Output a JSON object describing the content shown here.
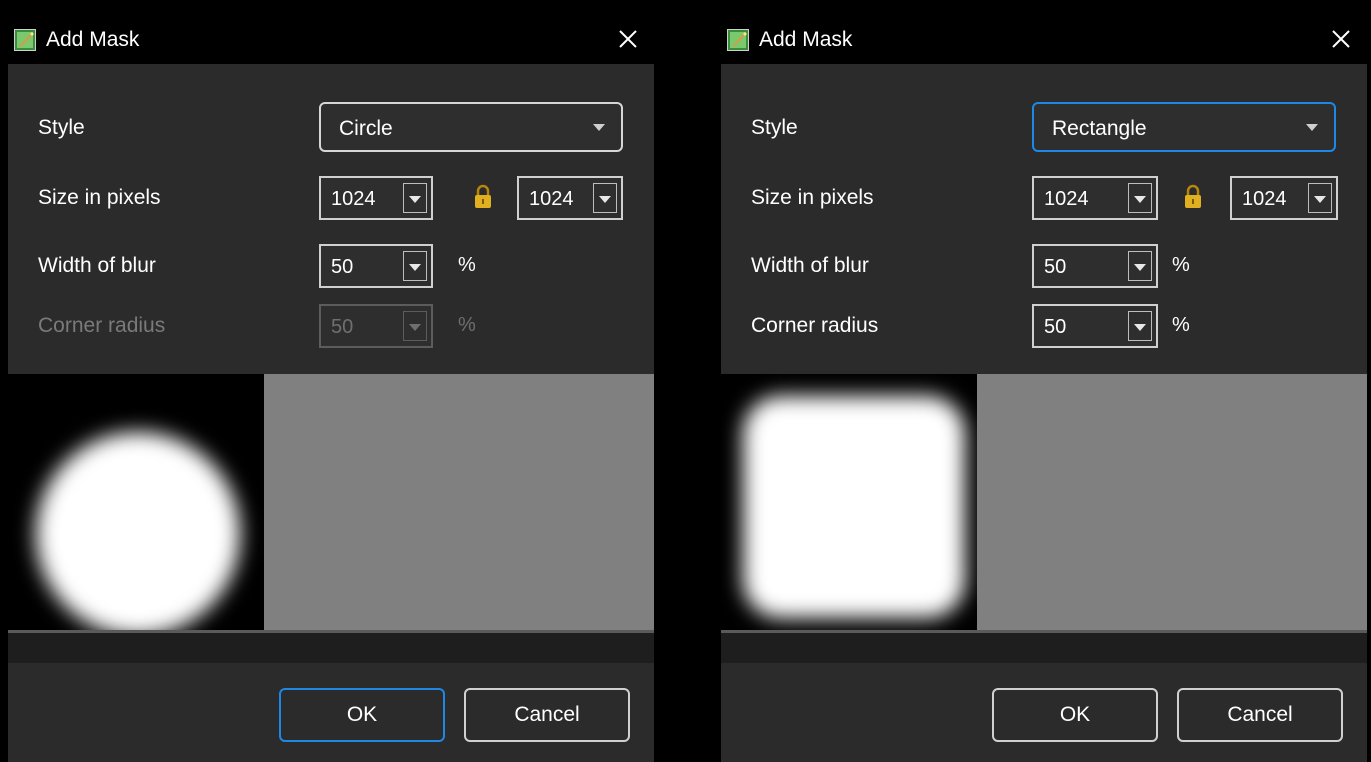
{
  "dialogs": [
    {
      "title": "Add Mask",
      "style_label": "Style",
      "style_value": "Circle",
      "size_label": "Size in pixels",
      "size_width": "1024",
      "size_height": "1024",
      "blur_label": "Width of blur",
      "blur_value": "50",
      "blur_unit": "%",
      "corner_label": "Corner radius",
      "corner_value": "50",
      "corner_unit": "%",
      "corner_enabled": false,
      "preview_shape": "circle",
      "ok_label": "OK",
      "cancel_label": "Cancel",
      "default_button": "ok"
    },
    {
      "title": "Add Mask",
      "style_label": "Style",
      "style_value": "Rectangle",
      "size_label": "Size in pixels",
      "size_width": "1024",
      "size_height": "1024",
      "blur_label": "Width of blur",
      "blur_value": "50",
      "blur_unit": "%",
      "corner_label": "Corner radius",
      "corner_value": "50",
      "corner_unit": "%",
      "corner_enabled": true,
      "preview_shape": "rounded-rectangle",
      "ok_label": "OK",
      "cancel_label": "Cancel",
      "default_button": "none"
    }
  ],
  "icons": {
    "app": "mask-app-icon",
    "close": "close-icon",
    "lock": "lock-icon"
  },
  "colors": {
    "accent": "#1e88e5",
    "dialog_bg": "#2b2b2b",
    "preview_bg": "#808080",
    "lock": "#d4a017"
  }
}
